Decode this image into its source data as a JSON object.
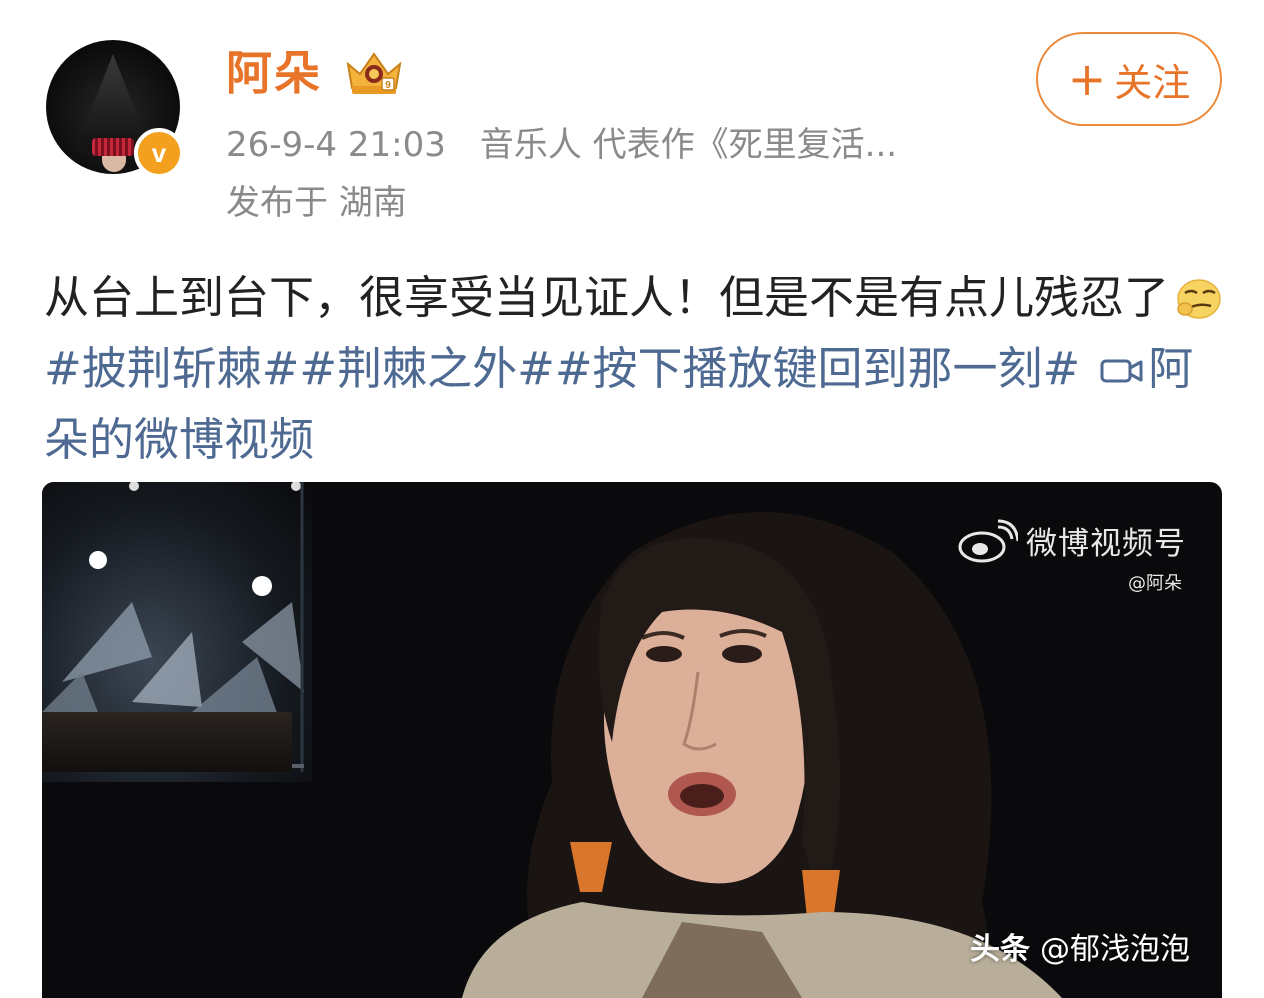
{
  "author": {
    "name": "阿朵",
    "badge": "v"
  },
  "post_meta": {
    "time": "26-9-4 21:03",
    "bio": "音乐人 代表作《死里复活...",
    "location": "发布于 湖南"
  },
  "follow_button": {
    "plus": "+",
    "label": "关注"
  },
  "post": {
    "text_line1": "从台上到台下，很享受当见证人！但是不是有点儿残忍了",
    "hashtags": [
      "#披荆斩棘#",
      "#荆棘之外#",
      "#按下播放键回到那一刻#"
    ],
    "video_link": "阿朵的微博视频"
  },
  "video": {
    "watermark_brand": "微博视频号",
    "watermark_handle": "@阿朵"
  },
  "overlay": {
    "brand": "头条",
    "handle": "@郁浅泡泡"
  },
  "colors": {
    "accent": "#e8742a",
    "link": "#4e6a92",
    "meta": "#8a8a8a",
    "verified": "#f2a01e"
  }
}
